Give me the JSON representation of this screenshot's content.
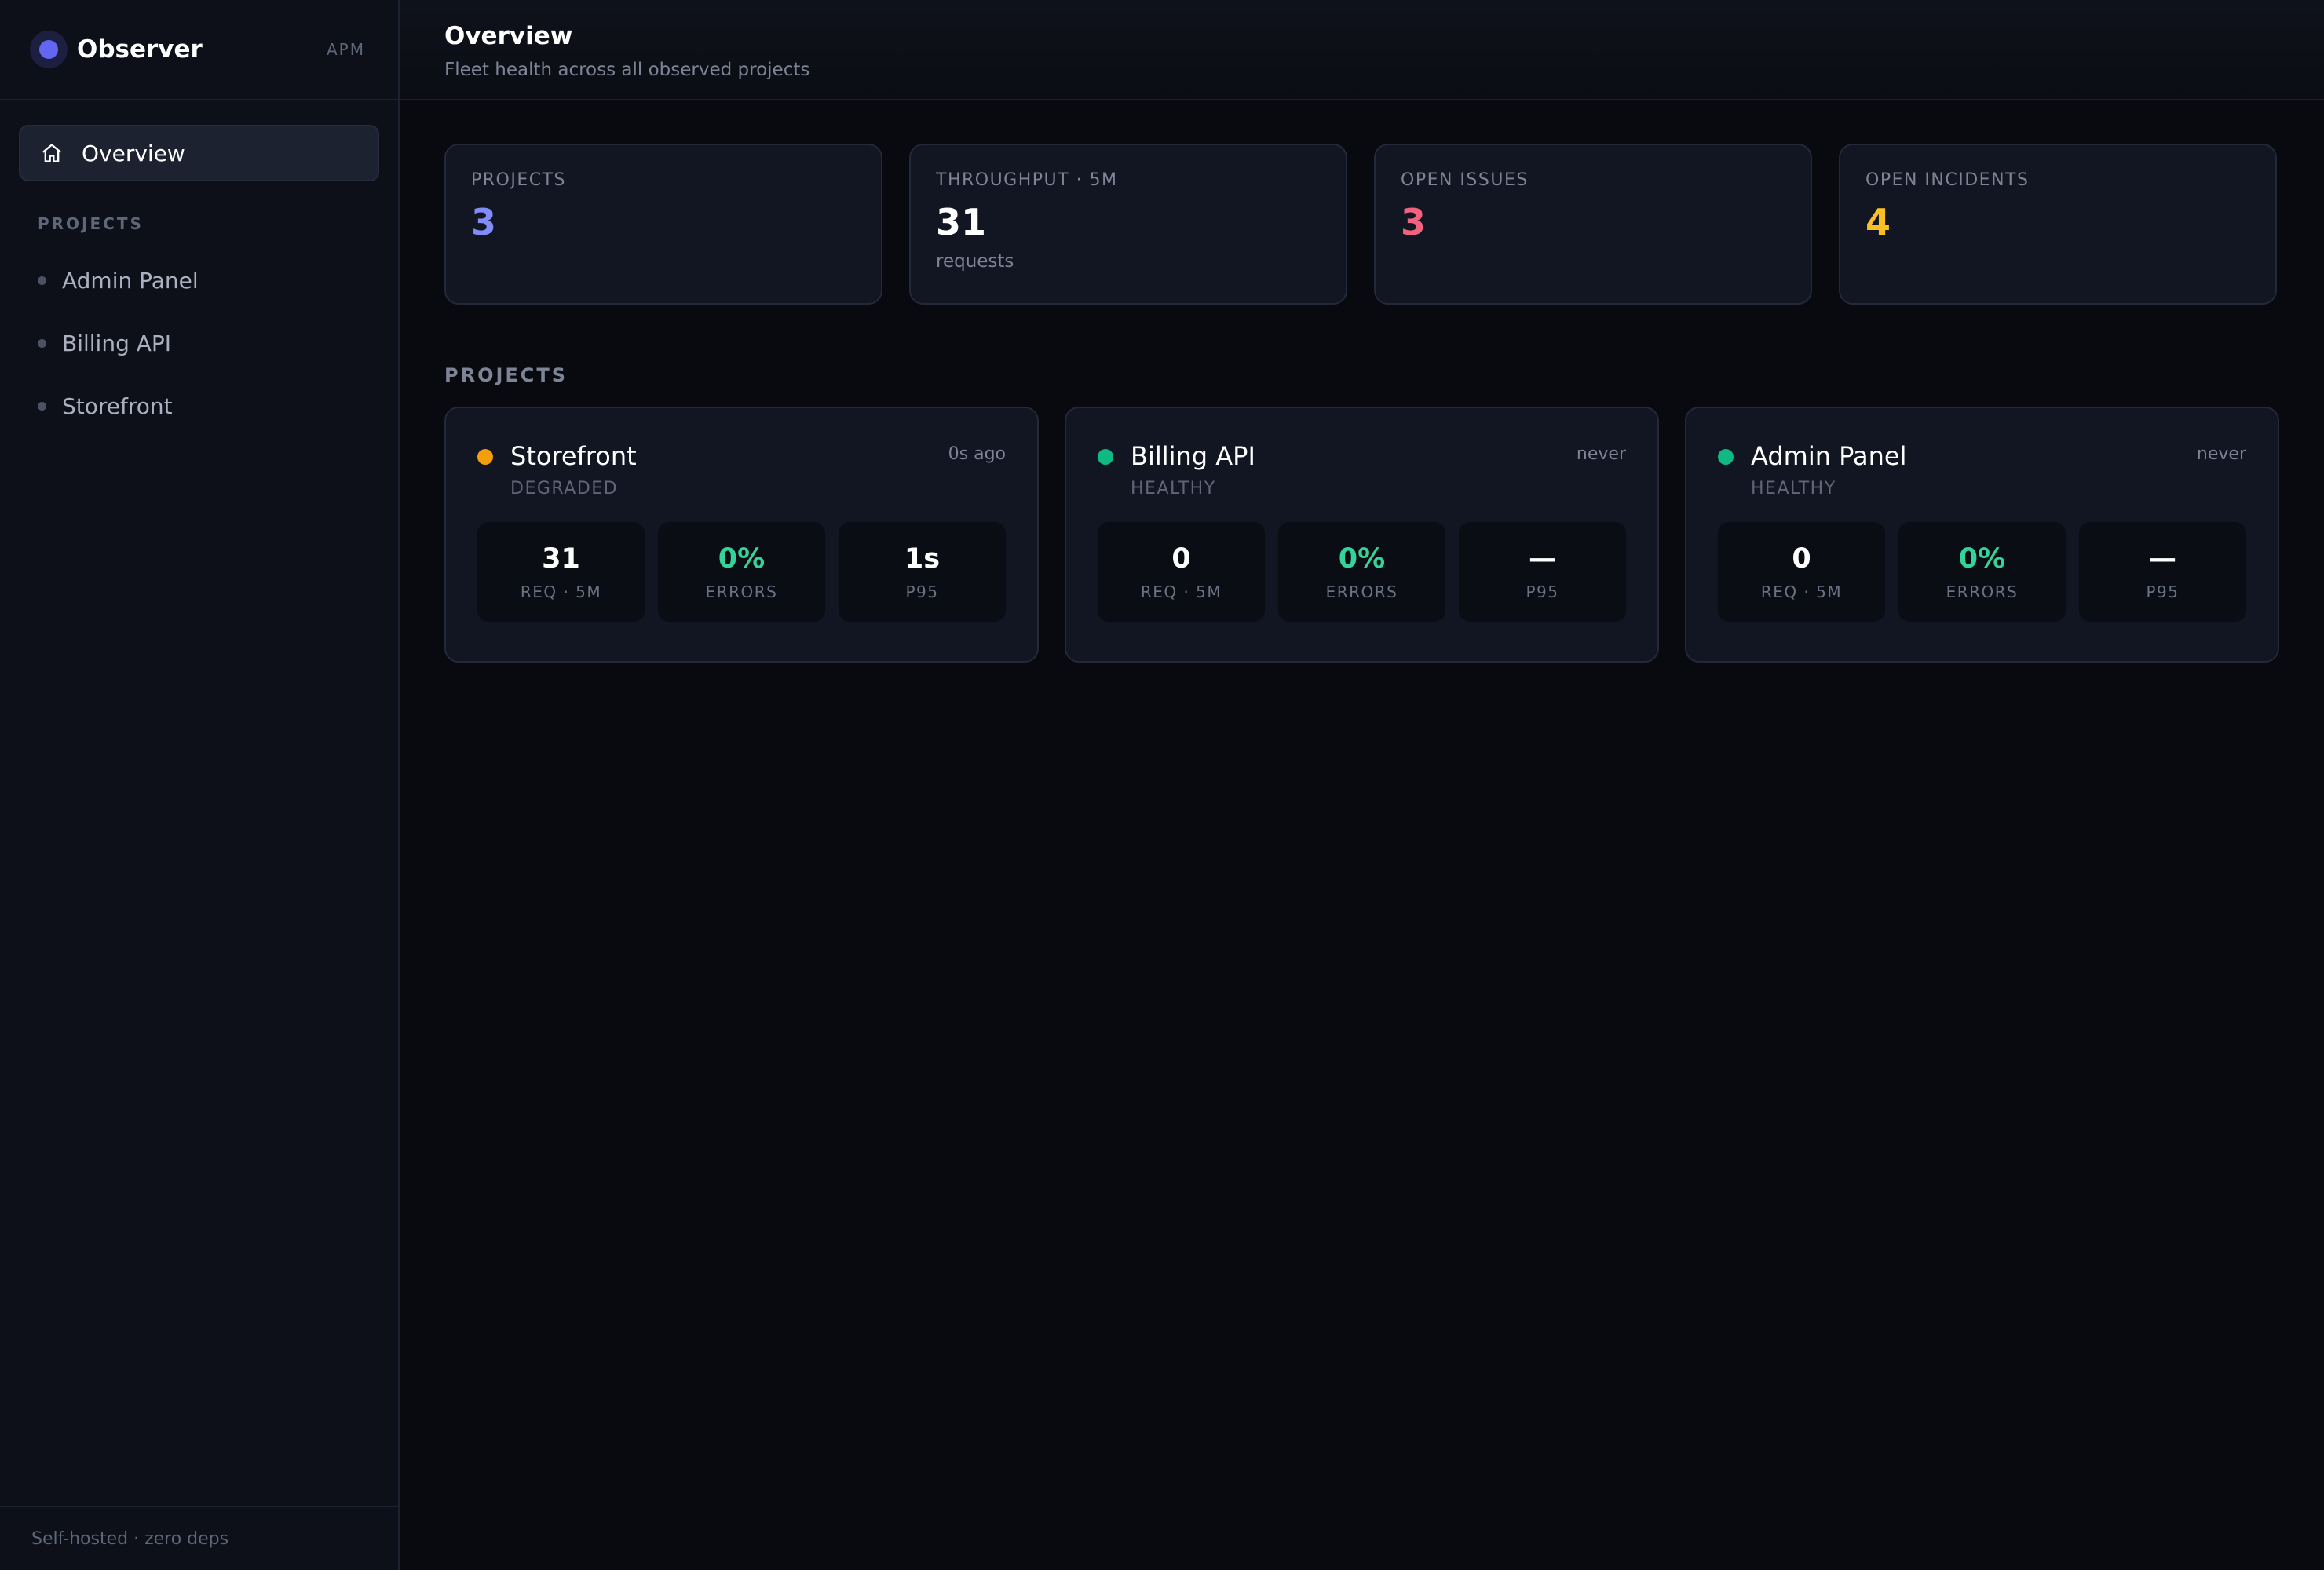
{
  "brand": {
    "name": "Observer",
    "tag": "APM",
    "accent": "#6366f1"
  },
  "nav": {
    "overview_label": "Overview",
    "projects_section": "PROJECTS",
    "projects": [
      {
        "label": "Admin Panel"
      },
      {
        "label": "Billing API"
      },
      {
        "label": "Storefront"
      }
    ]
  },
  "sidebar_footer": "Self-hosted · zero deps",
  "header": {
    "title": "Overview",
    "subtitle": "Fleet health across all observed projects"
  },
  "stats": [
    {
      "label": "PROJECTS",
      "value": "3",
      "sub": "",
      "color": "#818cf8"
    },
    {
      "label": "THROUGHPUT · 5M",
      "value": "31",
      "sub": "requests",
      "color": "#ffffff"
    },
    {
      "label": "OPEN ISSUES",
      "value": "3",
      "sub": "",
      "color": "#f0627e"
    },
    {
      "label": "OPEN INCIDENTS",
      "value": "4",
      "sub": "",
      "color": "#fbbf24"
    }
  ],
  "projects_section_title": "PROJECTS",
  "project_cards": [
    {
      "name": "Storefront",
      "status": "DEGRADED",
      "status_color": "#f59e0b",
      "last_seen": "0s ago",
      "metrics": [
        {
          "value": "31",
          "label": "REQ · 5M",
          "color": "#ffffff"
        },
        {
          "value": "0%",
          "label": "ERRORS",
          "color": "#34d399"
        },
        {
          "value": "1s",
          "label": "P95",
          "color": "#ffffff"
        }
      ]
    },
    {
      "name": "Billing API",
      "status": "HEALTHY",
      "status_color": "#10b981",
      "last_seen": "never",
      "metrics": [
        {
          "value": "0",
          "label": "REQ · 5M",
          "color": "#ffffff"
        },
        {
          "value": "0%",
          "label": "ERRORS",
          "color": "#34d399"
        },
        {
          "value": "—",
          "label": "P95",
          "color": "#ffffff"
        }
      ]
    },
    {
      "name": "Admin Panel",
      "status": "HEALTHY",
      "status_color": "#10b981",
      "last_seen": "never",
      "metrics": [
        {
          "value": "0",
          "label": "REQ · 5M",
          "color": "#ffffff"
        },
        {
          "value": "0%",
          "label": "ERRORS",
          "color": "#34d399"
        },
        {
          "value": "—",
          "label": "P95",
          "color": "#ffffff"
        }
      ]
    }
  ]
}
